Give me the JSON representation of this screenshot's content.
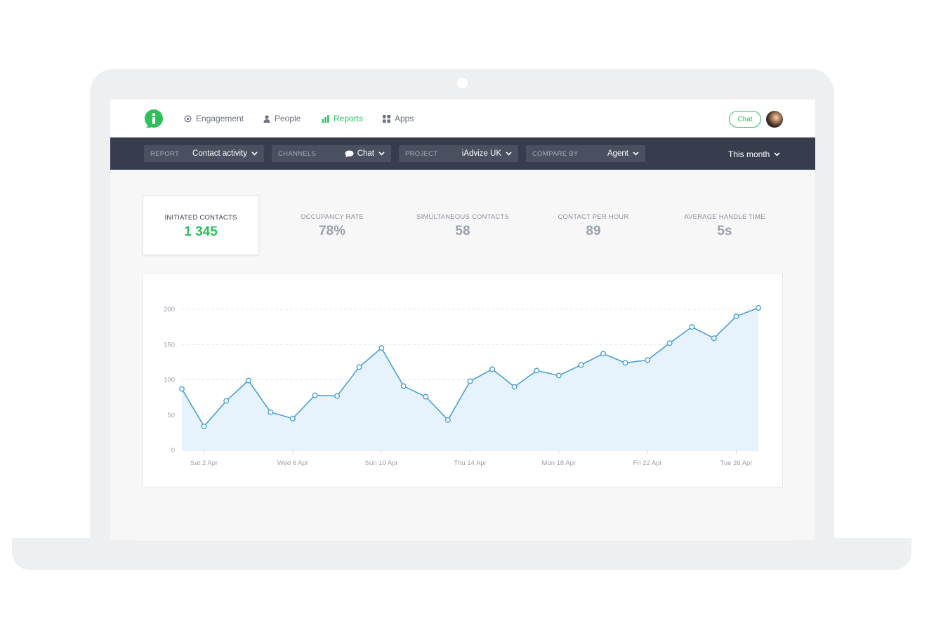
{
  "nav": {
    "items": [
      {
        "label": "Engagement",
        "icon": "target-icon"
      },
      {
        "label": "People",
        "icon": "person-icon"
      },
      {
        "label": "Reports",
        "icon": "bar-chart-icon",
        "active": true
      },
      {
        "label": "Apps",
        "icon": "grid-icon"
      }
    ],
    "chat_button": "Chat"
  },
  "filters": {
    "report": {
      "label": "REPORT",
      "value": "Contact activity"
    },
    "channels": {
      "label": "CHANNELS",
      "value": "Chat"
    },
    "project": {
      "label": "PROJECT",
      "value": "iAdvize UK"
    },
    "compare_by": {
      "label": "COMPARE BY",
      "value": "Agent"
    },
    "period": "This month"
  },
  "metrics": [
    {
      "label": "INITIATED CONTACTS",
      "value": "1 345",
      "selected": true
    },
    {
      "label": "OCCUPANCY RATE",
      "value": "78%"
    },
    {
      "label": "SIMULTANEOUS CONTACTS",
      "value": "58"
    },
    {
      "label": "CONTACT PER HOUR",
      "value": "89"
    },
    {
      "label": "AVERAGE HANDLE TIME",
      "value": "5s"
    }
  ],
  "colors": {
    "accent": "#2fbf5d",
    "line": "#4a9fd5",
    "area": "#e6f3fc",
    "filter_bar": "#373d4d"
  },
  "chart_data": {
    "type": "area",
    "x": [
      "Fri 1 Apr",
      "Sat 2 Apr",
      "Sun 3 Apr",
      "Mon 4 Apr",
      "Tue 5 Apr",
      "Wed 6 Apr",
      "Thu 7 Apr",
      "Fri 8 Apr",
      "Sat 9 Apr",
      "Sun 10 Apr",
      "Mon 11 Apr",
      "Tue 12 Apr",
      "Wed 13 Apr",
      "Thu 14 Apr",
      "Fri 15 Apr",
      "Sat 16 Apr",
      "Sun 17 Apr",
      "Mon 18 Apr",
      "Tue 19 Apr",
      "Wed 20 Apr",
      "Thu 21 Apr",
      "Fri 22 Apr",
      "Sat 23 Apr",
      "Sun 24 Apr",
      "Mon 25 Apr",
      "Tue 26 Apr",
      "Wed 27 Apr"
    ],
    "values": [
      87,
      34,
      70,
      99,
      54,
      45,
      78,
      77,
      118,
      145,
      91,
      76,
      43,
      98,
      115,
      90,
      113,
      106,
      121,
      137,
      124,
      128,
      152,
      175,
      159,
      190,
      202
    ],
    "xticks": [
      "Sat 2 Apr",
      "Wed 6 Apr",
      "Sun 10 Apr",
      "Thu 14 Apr",
      "Mon 18 Apr",
      "Fri 22 Apr",
      "Tue 26 Apr"
    ],
    "yticks": [
      0,
      50,
      100,
      150,
      200
    ],
    "ylim": [
      0,
      200
    ],
    "grid": true,
    "title": "",
    "xlabel": "",
    "ylabel": ""
  }
}
